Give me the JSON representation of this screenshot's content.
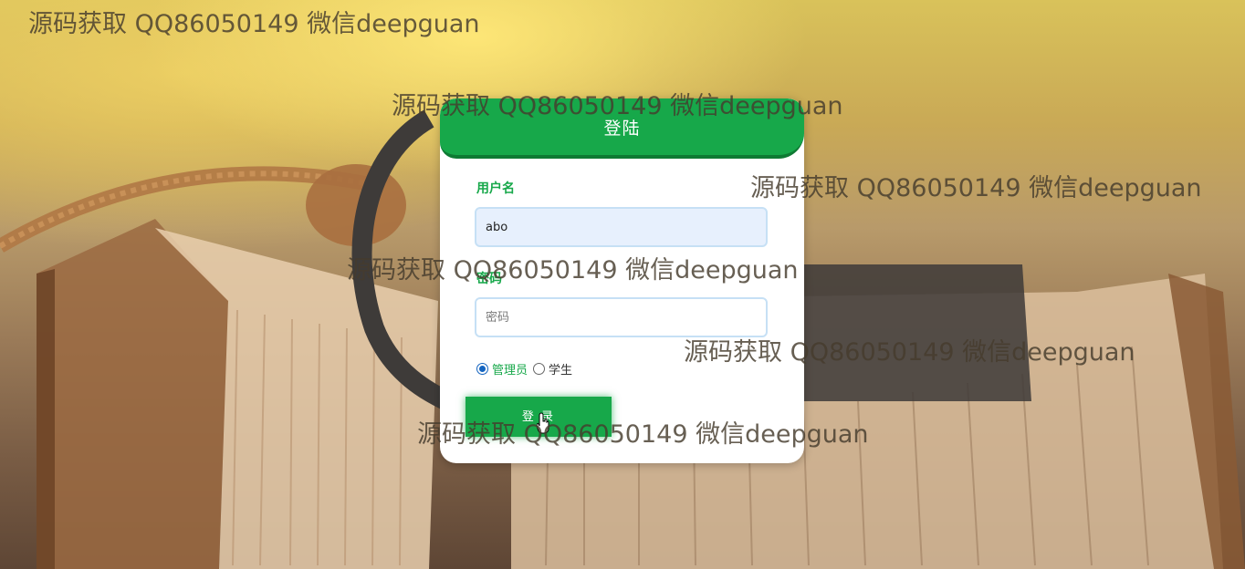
{
  "login": {
    "title": "登陆",
    "username_label": "用户名",
    "username_value": "abo",
    "password_label": "密码",
    "password_placeholder": "密码",
    "role_options": [
      "管理员",
      "学生"
    ],
    "selected_role": "管理员",
    "login_button": "登 录"
  },
  "watermarks": [
    "源码获取 QQ86050149 微信deepguan",
    "源码获取 QQ86050149 微信deepguan",
    "源码获取 QQ86050149 微信deepguan",
    "源码获取 QQ86050149 微信deepguan",
    "源码获取 QQ86050149 微信deepguan",
    "源码获取 QQ86050149 微信deepguan"
  ],
  "colors": {
    "accent": "#17a84a",
    "accent_dark": "#0e7a33",
    "input_border": "#c6e0f5",
    "input_fill": "#e7f0fd"
  }
}
